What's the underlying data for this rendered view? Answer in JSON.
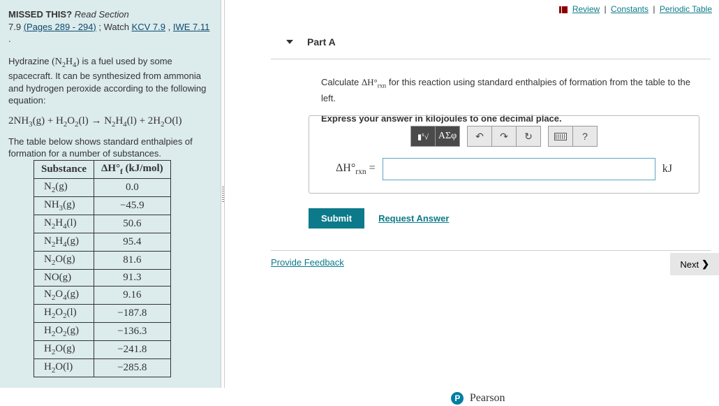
{
  "top_links": {
    "review": "Review",
    "constants": "Constants",
    "periodic": "Periodic Table"
  },
  "left": {
    "missed": "MISSED THIS?",
    "read": "Read Section",
    "section_ref": "7.9 ",
    "pages_link": "(Pages 289 - 294)",
    "watch": " ; Watch ",
    "kcv": "KCV 7.9",
    "comma": " , ",
    "iwe": "IWE 7.11",
    "period": " .",
    "intro1": "Hydrazine ",
    "intro2": " is a fuel used by some spacecraft. It can be synthesized from ammonia and hydrogen peroxide according to the following equation:",
    "formula_n2h4": "(N₂H₄)",
    "equation": "2NH₃(g) + H₂O₂(l) → N₂H₄(l) + 2H₂O(l)",
    "table_intro": "The table below shows standard enthalpies of formation for a number of substances.",
    "th_sub": "Substance",
    "th_val": "ΔH°f (kJ/mol)"
  },
  "chart_data": {
    "type": "table",
    "title": "Standard enthalpies of formation",
    "columns": [
      "Substance",
      "ΔH°f (kJ/mol)"
    ],
    "rows": [
      {
        "sub": "N₂(g)",
        "val": "0.0"
      },
      {
        "sub": "NH₃(g)",
        "val": "−45.9"
      },
      {
        "sub": "N₂H₄(l)",
        "val": "50.6"
      },
      {
        "sub": "N₂H₄(g)",
        "val": "95.4"
      },
      {
        "sub": "N₂O(g)",
        "val": "81.6"
      },
      {
        "sub": "NO(g)",
        "val": "91.3"
      },
      {
        "sub": "N₂O₄(g)",
        "val": "9.16"
      },
      {
        "sub": "H₂O₂(l)",
        "val": "−187.8"
      },
      {
        "sub": "H₂O₂(g)",
        "val": "−136.3"
      },
      {
        "sub": "H₂O(g)",
        "val": "−241.8"
      },
      {
        "sub": "H₂O(l)",
        "val": "−285.8"
      }
    ]
  },
  "part": {
    "label": "Part A",
    "q1a": "Calculate ",
    "q1b": " for this reaction using standard enthalpies of formation from the table to the left.",
    "delta": "ΔH°rxn",
    "q2": "Express your answer in kilojoules to one decimal place.",
    "lhs_eq": " =",
    "unit": "kJ",
    "toolbar": {
      "templates": "⬛√x",
      "greek": "ΑΣφ",
      "undo": "↶",
      "redo": "↷",
      "reset": "↻",
      "help": "?"
    },
    "submit": "Submit",
    "request": "Request Answer"
  },
  "feedback": "Provide Feedback",
  "next": "Next",
  "brand": "Pearson"
}
